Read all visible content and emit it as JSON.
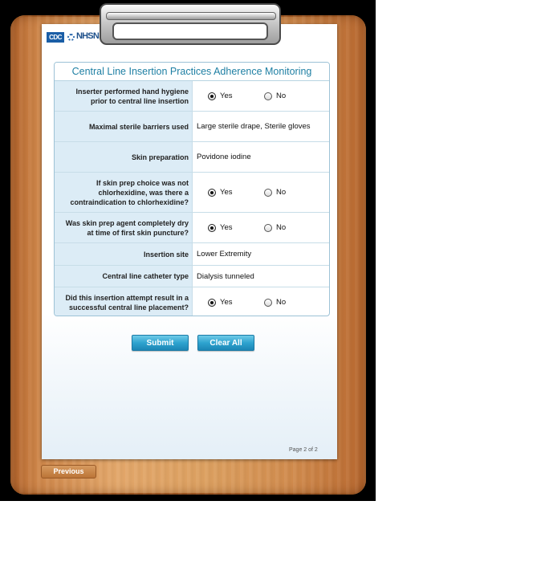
{
  "logos": {
    "cdc": "CDC",
    "nhsn": "NHSN"
  },
  "form": {
    "title": "Central Line Insertion Practices Adherence Monitoring",
    "rows": [
      {
        "question": "Inserter performed hand hygiene prior to central line insertion",
        "type": "radio",
        "yes_label": "Yes",
        "no_label": "No",
        "selected": "Yes"
      },
      {
        "question": "Maximal sterile barriers used",
        "type": "text",
        "answer": "Large sterile drape, Sterile gloves"
      },
      {
        "question": "Skin preparation",
        "type": "text",
        "answer": "Povidone iodine"
      },
      {
        "question": "If skin prep choice was not chlorhexidine, was there a contraindication to chlorhexidine?",
        "type": "radio",
        "yes_label": "Yes",
        "no_label": "No",
        "selected": "Yes"
      },
      {
        "question": "Was skin prep agent completely dry at time of first skin puncture?",
        "type": "radio",
        "yes_label": "Yes",
        "no_label": "No",
        "selected": "Yes"
      },
      {
        "question": "Insertion site",
        "type": "text",
        "answer": "Lower Extremity"
      },
      {
        "question": "Central line catheter type",
        "type": "text",
        "answer": "Dialysis tunneled"
      },
      {
        "question": "Did this insertion attempt result in a successful central line placement?",
        "type": "radio",
        "yes_label": "Yes",
        "no_label": "No",
        "selected": "Yes"
      }
    ]
  },
  "buttons": {
    "submit": "Submit",
    "clear": "Clear All",
    "previous": "Previous"
  },
  "pagination": {
    "label": "Page 2 of 2"
  },
  "colors": {
    "accent": "#1e7fa3",
    "question_bg": "#dcecf6",
    "button": "#2ea3cf",
    "board": "#dca060"
  }
}
